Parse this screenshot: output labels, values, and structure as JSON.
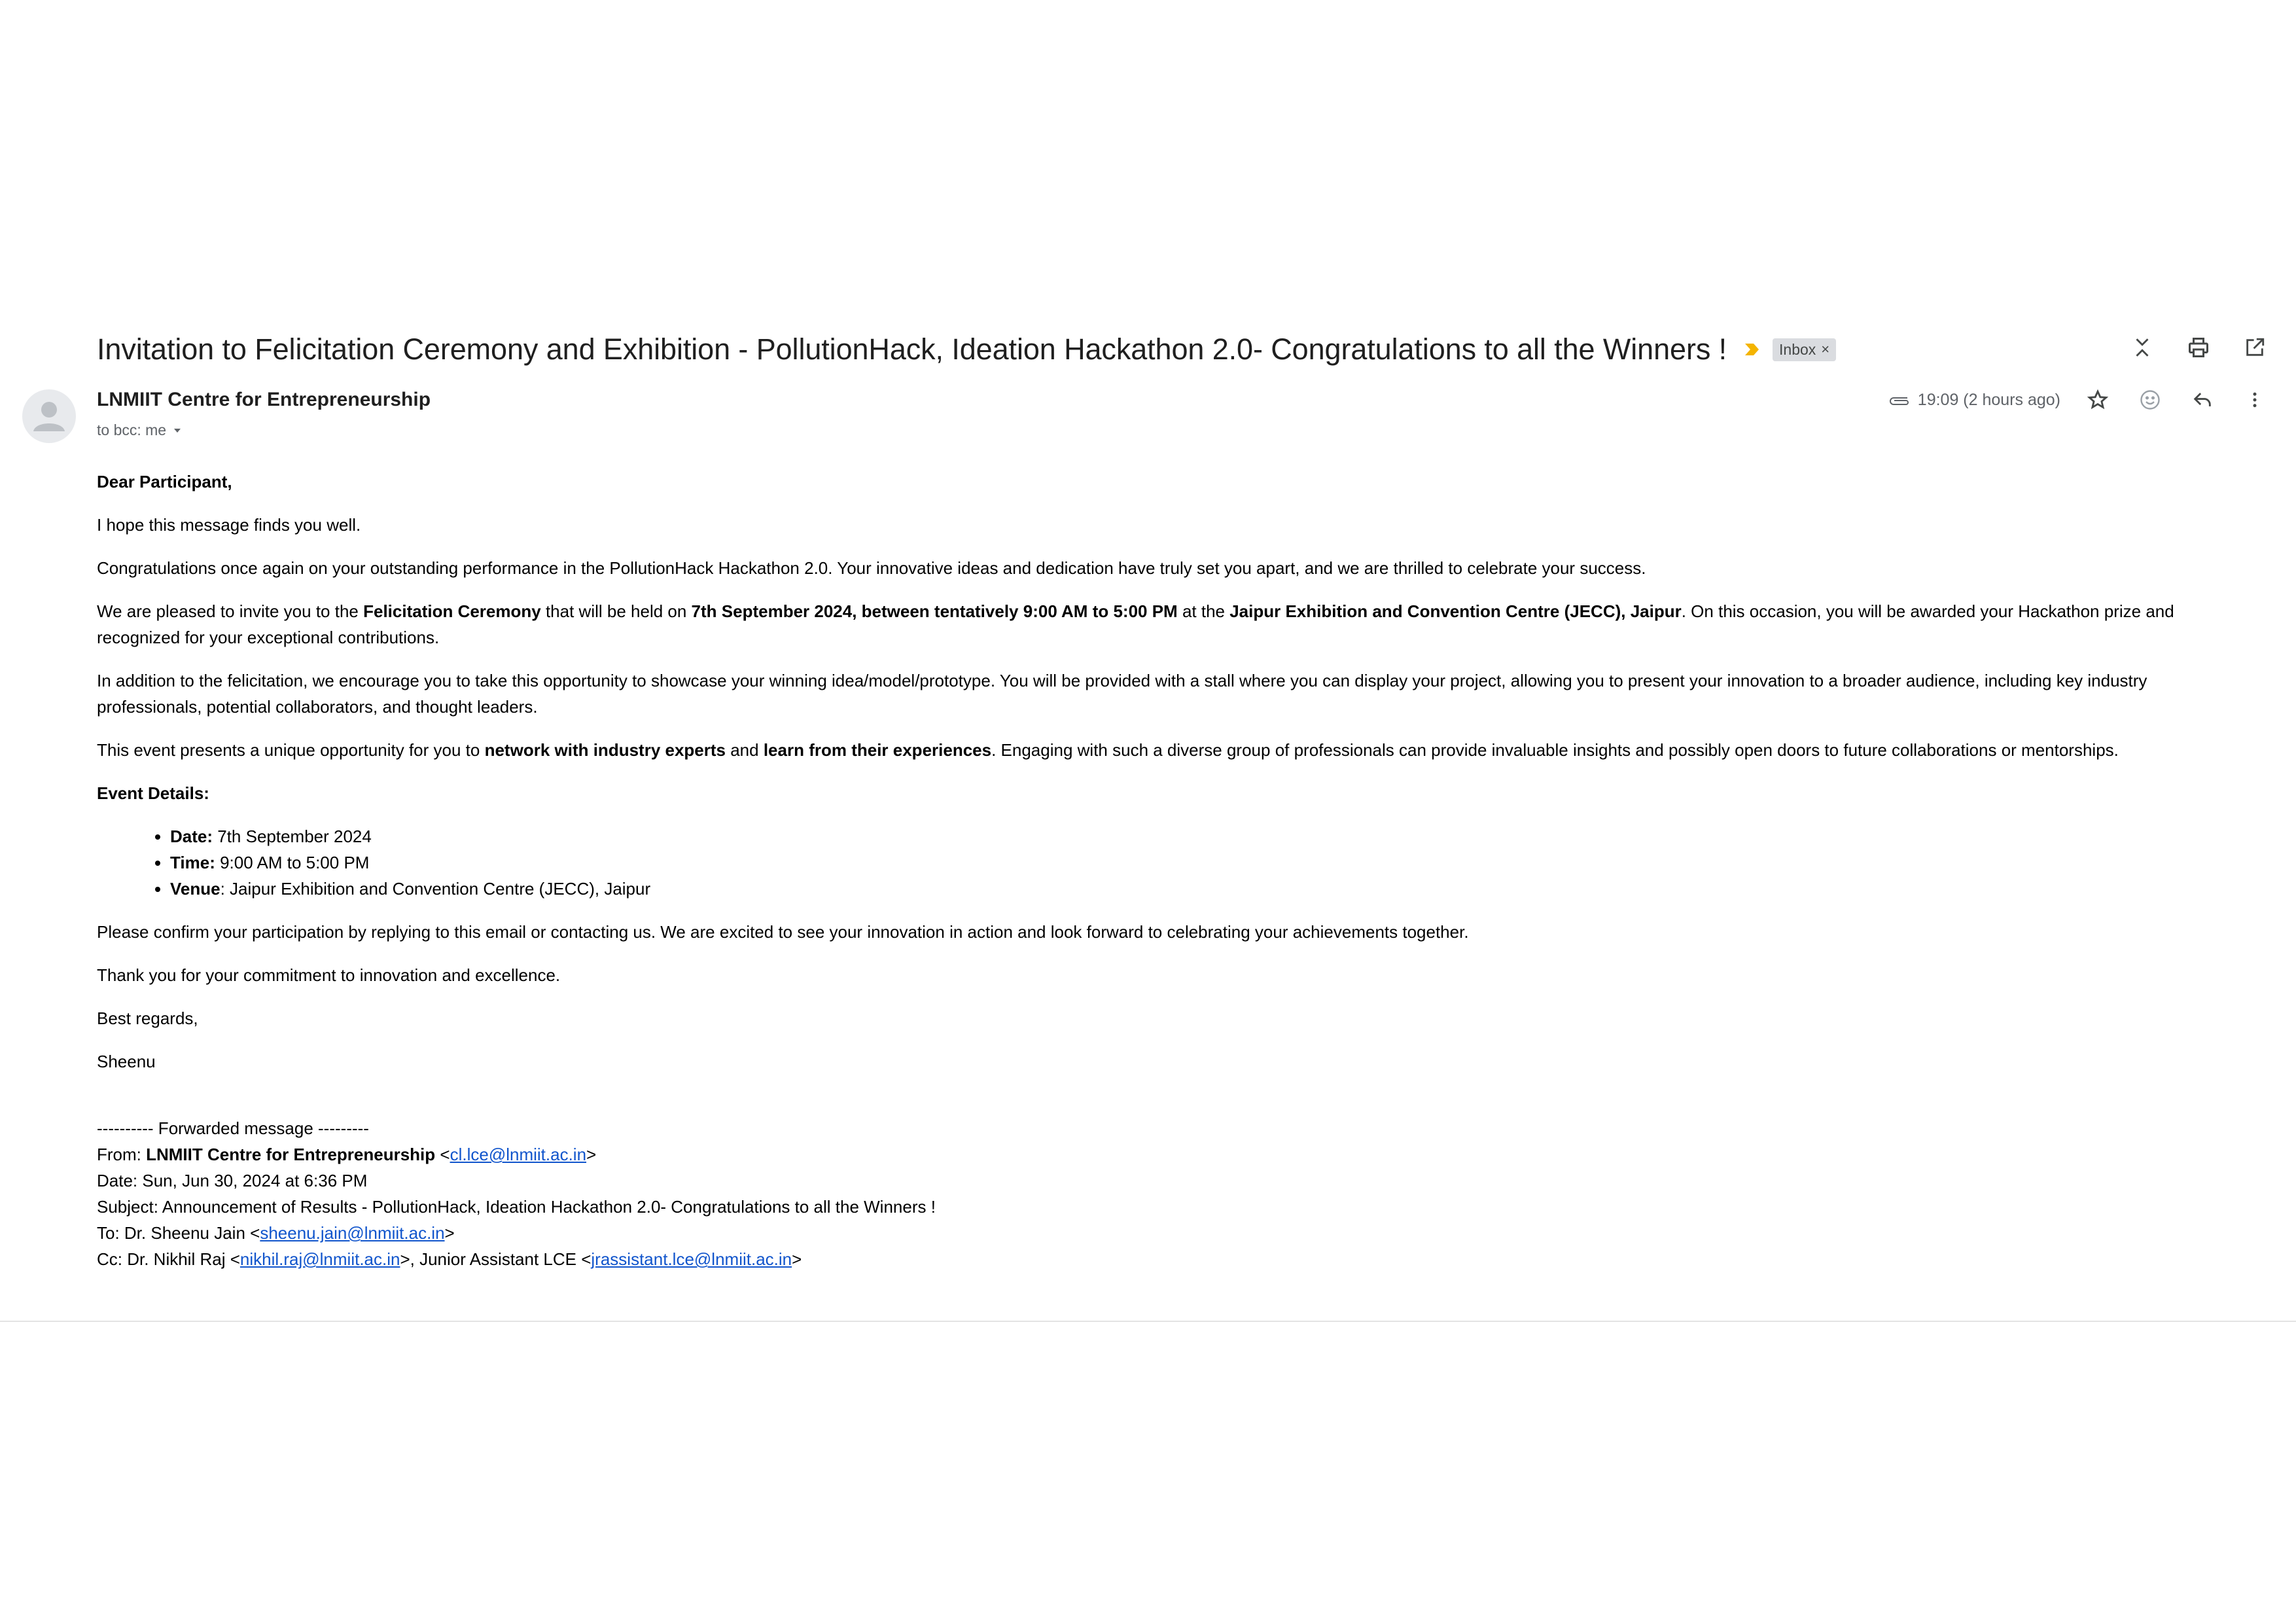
{
  "email": {
    "subject": "Invitation to Felicitation Ceremony and Exhibition - PollutionHack, Ideation Hackathon 2.0- Congratulations to all the Winners !",
    "label": "Inbox",
    "label_remove": "×",
    "sender": "LNMIIT Centre for Entrepreneurship",
    "recipients": "to bcc: me",
    "time": "19:09 (2 hours ago)"
  },
  "body": {
    "greeting": "Dear Participant,",
    "p1": "I hope this message finds you well.",
    "p2": "Congratulations once again on your outstanding performance in the PollutionHack Hackathon 2.0. Your innovative ideas and dedication have truly set you apart, and we are thrilled to celebrate your success.",
    "p3": {
      "t1": "We are pleased to invite you to the ",
      "b1": "Felicitation Ceremony",
      "t2": " that will be held on ",
      "b2": "7th September 2024, between tentatively 9:00 AM to 5:00 PM",
      "t3": " at the ",
      "b3": "Jaipur Exhibition and Convention Centre (JECC), Jaipur",
      "t4": ". On this occasion, you will be awarded your Hackathon prize and recognized for your exceptional contributions."
    },
    "p4": "In addition to the felicitation, we encourage you to take this opportunity to showcase your winning idea/model/prototype. You will be provided with a stall where you can display your project, allowing you to present your innovation to a broader audience, including key industry professionals, potential collaborators, and thought leaders.",
    "p5": {
      "t1": "This event presents a unique opportunity for you to ",
      "b1": "network with industry experts",
      "t2": " and ",
      "b2": "learn from their experiences",
      "t3": ". Engaging with such a diverse group of professionals can provide invaluable insights and possibly open doors to future collaborations or mentorships."
    },
    "details_heading": "Event Details:",
    "details": [
      {
        "label": "Date:",
        "value": " 7th September 2024"
      },
      {
        "label": "Time:",
        "value": " 9:00 AM to 5:00 PM"
      },
      {
        "label": "Venue",
        "value": ": Jaipur Exhibition and Convention Centre (JECC), Jaipur"
      }
    ],
    "p6": "Please confirm your participation by replying to this email or contacting us.  We are excited to see your innovation in action and look forward to celebrating your achievements together.",
    "p7": "Thank you for your commitment to innovation and excellence.",
    "closing": "Best regards,",
    "signature": "Sheenu"
  },
  "forwarded": {
    "header": "---------- Forwarded message ---------",
    "from_label": "From: ",
    "from_name": "LNMIIT Centre for Entrepreneurship",
    "from_email": "cl.lce@lnmiit.ac.in",
    "date": "Date: Sun, Jun 30, 2024 at 6:36 PM",
    "subject": "Subject: Announcement of Results - PollutionHack, Ideation Hackathon 2.0- Congratulations to all the Winners !",
    "to_label": "To: Dr. Sheenu Jain <",
    "to_email": "sheenu.jain@lnmiit.ac.in",
    "cc_label": "Cc: Dr. Nikhil Raj <",
    "cc_email1": "nikhil.raj@lnmiit.ac.in",
    "cc_mid": ">, Junior Assistant LCE <",
    "cc_email2": "jrassistant.lce@lnmiit.ac.in",
    "lt": "<",
    "gt": ">"
  },
  "icons": {
    "collapse": "collapse-all-icon",
    "print": "print-icon",
    "open_new": "open-in-new-window-icon",
    "attachment": "attachment-icon",
    "star": "star-icon",
    "emoji": "emoji-icon",
    "reply": "reply-icon",
    "more": "more-vert-icon"
  },
  "colors": {
    "link": "#1155cc",
    "important": "#f4b400",
    "chip": "#dadce0"
  }
}
